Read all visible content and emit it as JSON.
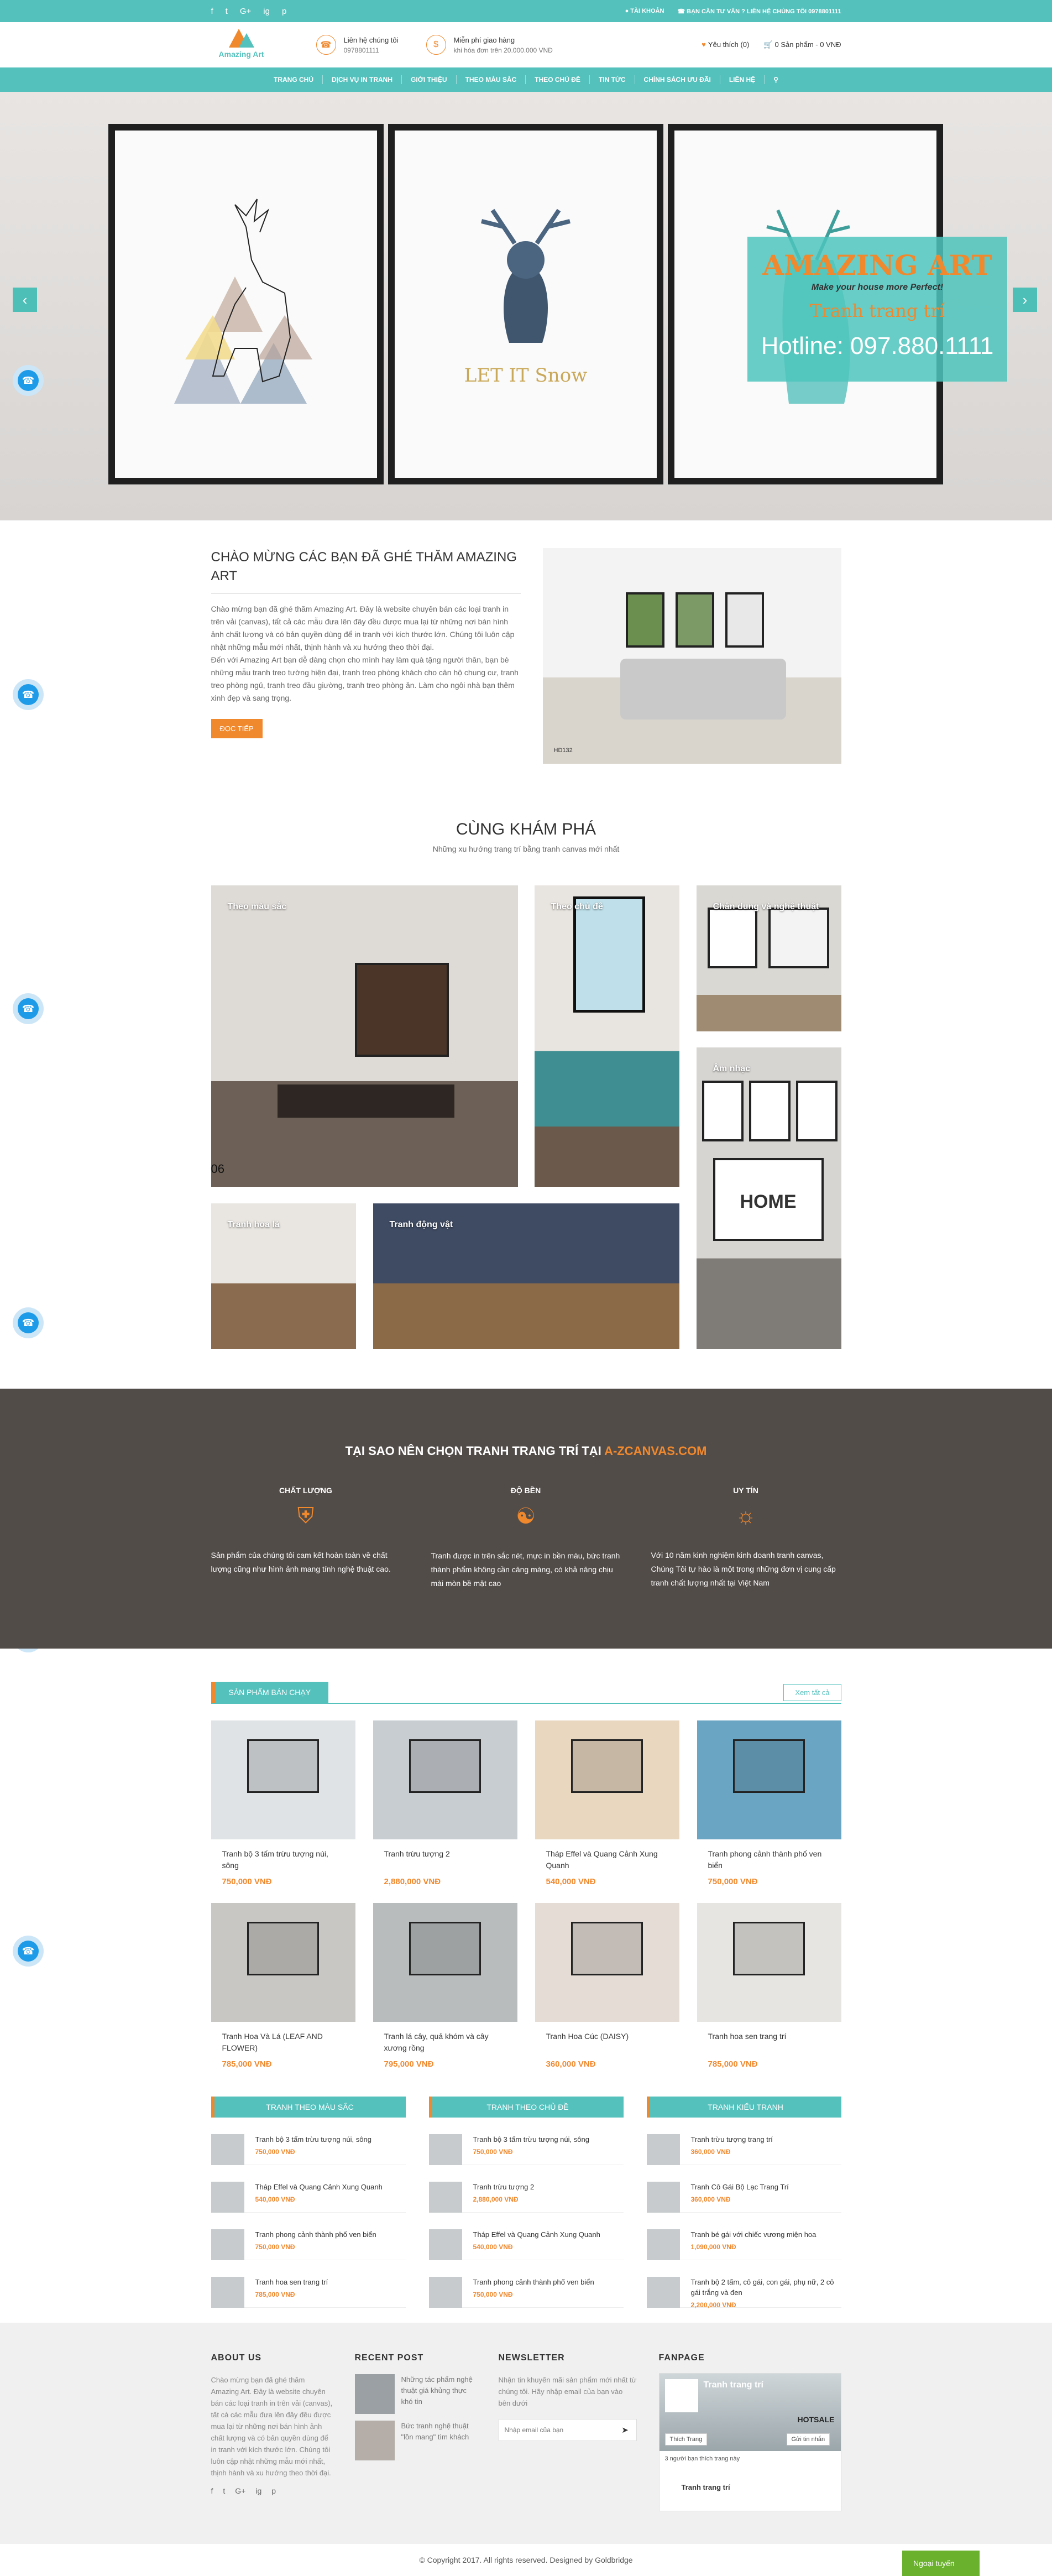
{
  "topbar": {
    "social": [
      "f",
      "t",
      "G+",
      "ig",
      "p"
    ],
    "account": "TÀI KHOẢN",
    "hotline": "BẠN CẦN TƯ VẤN ? LIÊN HỆ CHÚNG TÔI 0978801111"
  },
  "header": {
    "logo_text": "Amazing Art",
    "contact_title": "Liên hệ chúng tôi",
    "contact_phone": "0978801111",
    "ship_title": "Miễn phí giao hàng",
    "ship_sub": "khi hóa đơn trên 20.000.000 VNĐ",
    "wishlist": "Yêu thích (0)",
    "cart": "0 Sản phẩm - 0 VNĐ"
  },
  "nav": [
    "TRANG CHỦ",
    "DỊCH VỤ IN TRANH",
    "GIỚI THIỆU",
    "THEO MÀU SẮC",
    "THEO CHỦ ĐỀ",
    "TIN TỨC",
    "CHÍNH SÁCH ƯU ĐÃI",
    "LIÊN HỆ"
  ],
  "hero": {
    "promo_title": "AMAZING ART",
    "promo_slogan": "Make your house more Perfect!",
    "promo_sub": "Tranh trang trí",
    "promo_hotline": "Hotline: 097.880.1111",
    "frame2_text": "LET IT Snow"
  },
  "welcome": {
    "title": "CHÀO MỪNG CÁC BẠN ĐÃ GHÉ THĂM AMAZING ART",
    "p1": "Chào mừng bạn đã ghé thăm Amazing Art. Đây là website chuyên bán các loại tranh in trên vải (canvas), tất cả các mẫu đưa lên đây đều được mua lại từ những nơi bán hình ảnh chất lượng và có bản quyền dùng để in tranh với kích thước lớn. Chúng tôi luôn cập nhật những mẫu mới nhất, thịnh hành và xu hướng theo thời đại.",
    "p2": "Đến với Amazing Art bạn dễ dàng chọn cho mình hay làm quà tặng người thân, bạn bè những mẫu tranh treo tường hiện đại, tranh treo phòng khách cho căn hộ chung cư, tranh treo phòng ngủ, tranh treo đầu giường, tranh treo phòng ăn. Làm cho ngôi nhà bạn thêm xinh đẹp và sang trọng.",
    "button": "ĐỌC TIẾP",
    "image_code": "HD132"
  },
  "explore": {
    "title": "CÙNG KHÁM PHÁ",
    "subtitle": "Những xu hướng trang trí bằng tranh canvas mới nhất",
    "tiles": [
      "Theo màu sắc",
      "Theo chủ đề",
      "Chân dung và nghệ thuật",
      "Âm nhạc",
      "Tranh hoa lá",
      "Tranh động vật"
    ],
    "tile1_code": "06"
  },
  "why": {
    "title": "TẠI SAO NÊN CHỌN TRANH TRANG TRÍ TẠI ",
    "brand": "A-ZCANVAS.COM",
    "cols": [
      {
        "title": "CHẤT LƯỢNG",
        "icon": "shield-icon",
        "text": "Sản phẩm của chúng tôi cam kết hoàn toàn về chất lượng cũng như hình ảnh mang tính nghệ thuật cao."
      },
      {
        "title": "ĐỘ BỀN",
        "icon": "nodes-icon",
        "text": "Tranh được in trên sắc nét, mực in bền màu, bức tranh thành phẩm không cần căng màng, có khả năng chịu mài mòn bề mặt cao"
      },
      {
        "title": "UY TÍN",
        "icon": "bulb-icon",
        "text": "Với 10 năm kinh nghiệm kinh doanh tranh canvas, Chúng Tôi tự hào là một trong những đơn vị cung cấp tranh chất lượng nhất tại Việt Nam"
      }
    ]
  },
  "bestseller": {
    "title": "SẢN PHẨM BÁN CHẠY",
    "more": "Xem tất cả",
    "products": [
      {
        "name": "Tranh bộ 3 tấm trừu tượng núi, sông",
        "price": "750,000 VNĐ",
        "bg": "#dfe3e6"
      },
      {
        "name": "Tranh trừu tượng 2",
        "price": "2,880,000 VNĐ",
        "bg": "#c8cdd2"
      },
      {
        "name": "Tháp Effel và Quang Cảnh Xung Quanh",
        "price": "540,000 VNĐ",
        "bg": "#e9d7c0"
      },
      {
        "name": "Tranh phong cảnh thành phố ven biển",
        "price": "750,000 VNĐ",
        "bg": "#6aa5c4"
      },
      {
        "name": "Tranh Hoa Và Lá (LEAF AND FLOWER)",
        "price": "785,000 VNĐ",
        "bg": "#c9c7c4"
      },
      {
        "name": "Tranh lá cây, quả khóm và cây xương rồng",
        "price": "795,000 VNĐ",
        "bg": "#b9bcbd"
      },
      {
        "name": "Tranh Hoa Cúc (DAISY)",
        "price": "360,000 VNĐ",
        "bg": "#e5dcd6"
      },
      {
        "name": "Tranh hoa sen trang trí",
        "price": "785,000 VNĐ",
        "bg": "#e7e5e1"
      }
    ]
  },
  "lists": [
    {
      "title": "TRANH THEO MÀU SẮC",
      "items": [
        {
          "name": "Tranh bộ 3 tấm trừu tượng núi, sông",
          "price": "750,000 VNĐ"
        },
        {
          "name": "Tháp Effel và Quang Cảnh Xung Quanh",
          "price": "540,000 VNĐ"
        },
        {
          "name": "Tranh phong cảnh thành phố ven biển",
          "price": "750,000 VNĐ"
        },
        {
          "name": "Tranh hoa sen trang trí",
          "price": "785,000 VNĐ"
        }
      ]
    },
    {
      "title": "TRANH THEO CHỦ ĐỀ",
      "items": [
        {
          "name": "Tranh bộ 3 tấm trừu tượng núi, sông",
          "price": "750,000 VNĐ"
        },
        {
          "name": "Tranh trừu tượng 2",
          "price": "2,880,000 VNĐ"
        },
        {
          "name": "Tháp Effel và Quang Cảnh Xung Quanh",
          "price": "540,000 VNĐ"
        },
        {
          "name": "Tranh phong cảnh thành phố ven biển",
          "price": "750,000 VNĐ"
        }
      ]
    },
    {
      "title": "TRANH KIỂU TRANH",
      "items": [
        {
          "name": "Tranh trừu tượng trang trí",
          "price": "360,000 VNĐ"
        },
        {
          "name": "Tranh Cô Gái Bộ Lạc Trang Trí",
          "price": "360,000 VNĐ"
        },
        {
          "name": "Tranh bé gái với chiếc vương miện hoa",
          "price": "1,090,000 VNĐ"
        },
        {
          "name": "Tranh bộ 2 tấm, cô gái, con gái, phụ nữ, 2 cô gái trắng và đen",
          "price": "2,200,000 VNĐ"
        }
      ]
    }
  ],
  "footer": {
    "about_title": "ABOUT US",
    "about_text": "Chào mừng bạn đã ghé thăm Amazing Art. Đây là website chuyên bán các loại tranh in trên vải (canvas), tất cả các mẫu đưa lên đây đều được mua lại từ những nơi bán hình ảnh chất lượng và có bản quyền dùng để in tranh với kích thước lớn. Chúng tôi luôn cập nhật những mẫu mới nhất, thịnh hành và xu hướng theo thời đại.",
    "recent_title": "RECENT POST",
    "posts": [
      "Những tác phẩm nghệ thuật giá khủng thực khó tin",
      "Bức tranh nghệ thuật \"lồn mang\" tìm khách"
    ],
    "newsletter_title": "NEWSLETTER",
    "newsletter_text": "Nhận tin khuyến mãi sản phẩm mới nhất từ chúng tôi. Hãy nhập email của bạn vào bên dưới",
    "newsletter_placeholder": "Nhập email của bạn",
    "fanpage_title": "FANPAGE",
    "fb_page": "Tranh trang trí",
    "fb_like": "Thích Trang",
    "fb_share": "Gửi tin nhắn",
    "fb_count": "3 người bạn thích trang này",
    "fb_hotsale": "HOTSALE"
  },
  "copyright": "© Copyright 2017. All rights reserved. Designed by Goldbridge",
  "online": "Ngoại tuyến",
  "colors": {
    "teal": "#55c1bd",
    "orange": "#f0882d",
    "dark": "#524c49"
  }
}
